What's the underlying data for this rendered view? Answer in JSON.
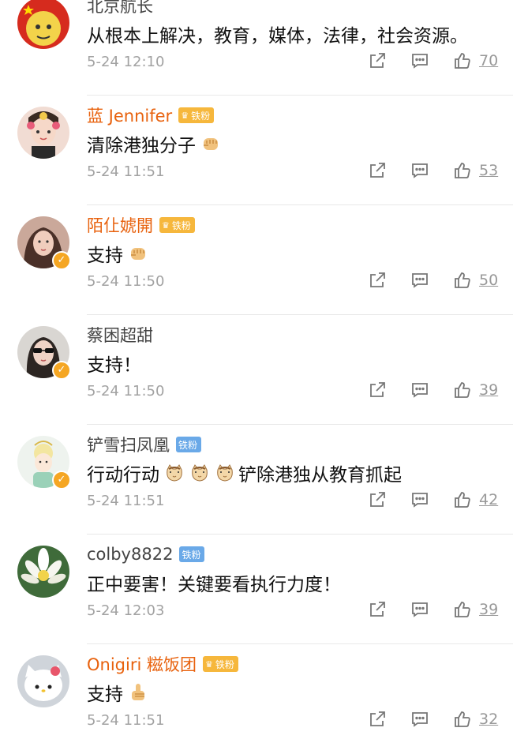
{
  "comments": [
    {
      "name": "北京航长",
      "name_style": "gray",
      "badge": "",
      "text": "从根本上解决，教育，媒体，法律，社会资源。",
      "emoji": "",
      "time": "5-24 12:10",
      "likes": "70",
      "verified": false,
      "avatar": "flag-face"
    },
    {
      "name": "蓝 Jennifer",
      "name_style": "orange",
      "badge": "铁粉",
      "badge_style": "gold",
      "text": "清除港独分子",
      "emoji": "fist",
      "time": "5-24 11:51",
      "likes": "53",
      "verified": false,
      "avatar": "flower-girl"
    },
    {
      "name": "陌仩婋開",
      "name_style": "orange",
      "badge": "铁粉",
      "badge_style": "gold",
      "text": "支持",
      "emoji": "fist",
      "time": "5-24 11:50",
      "likes": "50",
      "verified": true,
      "avatar": "portrait"
    },
    {
      "name": "蔡困超甜",
      "name_style": "gray",
      "badge": "",
      "text": "支持！",
      "emoji": "",
      "time": "5-24 11:50",
      "likes": "39",
      "verified": true,
      "avatar": "sunglasses"
    },
    {
      "name": "铲雪扫凤凰",
      "name_style": "gray",
      "badge": "铁粉",
      "badge_style": "blue",
      "text": "行动行动",
      "emoji": "cats",
      "text2": "铲除港独从教育抓起",
      "time": "5-24 11:51",
      "likes": "42",
      "verified": true,
      "avatar": "cartoon"
    },
    {
      "name": "colby8822",
      "name_style": "gray",
      "badge": "铁粉",
      "badge_style": "blue",
      "text": "正中要害！关键要看执行力度！",
      "emoji": "",
      "time": "5-24 12:03",
      "likes": "39",
      "verified": false,
      "avatar": "lotus"
    },
    {
      "name": "Onigiri 糍饭团",
      "name_style": "orange",
      "badge": "铁粉",
      "badge_style": "gold",
      "text": "支持",
      "emoji": "thumb",
      "time": "5-24 11:51",
      "likes": "32",
      "verified": false,
      "avatar": "kitty"
    }
  ]
}
